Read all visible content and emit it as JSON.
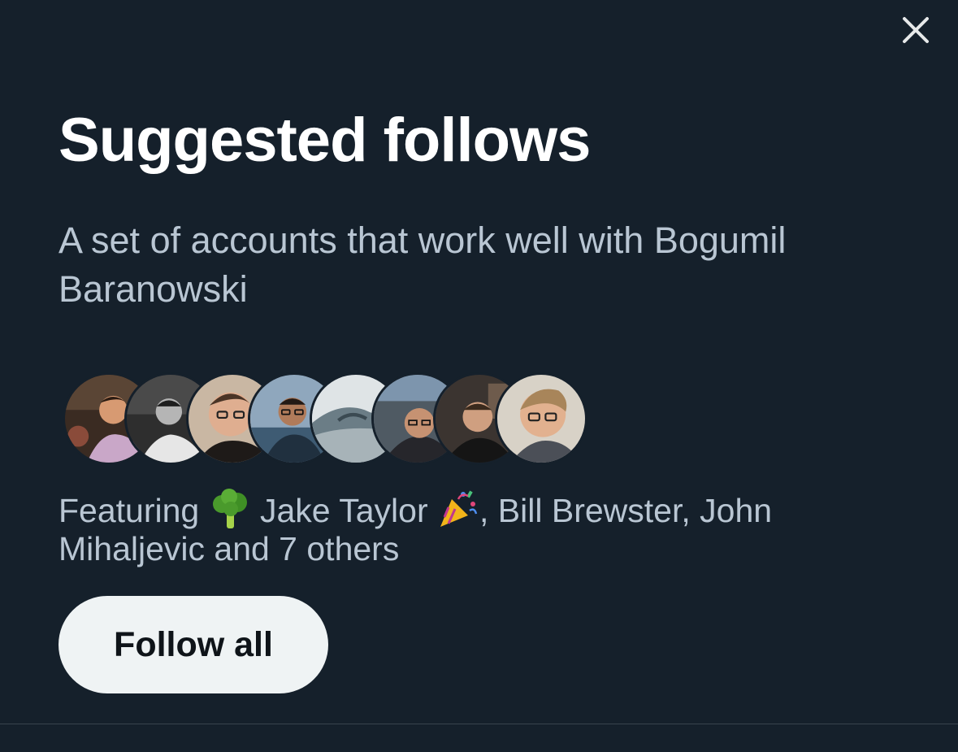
{
  "dialog": {
    "close_icon": "close-icon",
    "title": "Suggested follows",
    "subtitle": "A set of accounts that work well with Bogumil Baranowski",
    "avatars": [
      {
        "icon": "avatar-photo"
      },
      {
        "icon": "avatar-photo"
      },
      {
        "icon": "avatar-photo"
      },
      {
        "icon": "avatar-photo"
      },
      {
        "icon": "avatar-photo"
      },
      {
        "icon": "avatar-photo"
      },
      {
        "icon": "avatar-photo"
      },
      {
        "icon": "avatar-photo"
      }
    ],
    "featuring": {
      "prefix": "Featuring ",
      "emoji_1": "broccoli-emoji",
      "name_1": " Jake Taylor ",
      "emoji_2": "party-popper-emoji",
      "rest": ", Bill Brewster, John Mihaljevic and 7 others"
    },
    "follow_all_label": "Follow all"
  },
  "colors": {
    "background": "#15202b",
    "title": "#ffffff",
    "secondary_text": "#b9c6d3",
    "button_bg": "#eff3f4",
    "button_text": "#0f1419",
    "divider": "#38444d"
  }
}
